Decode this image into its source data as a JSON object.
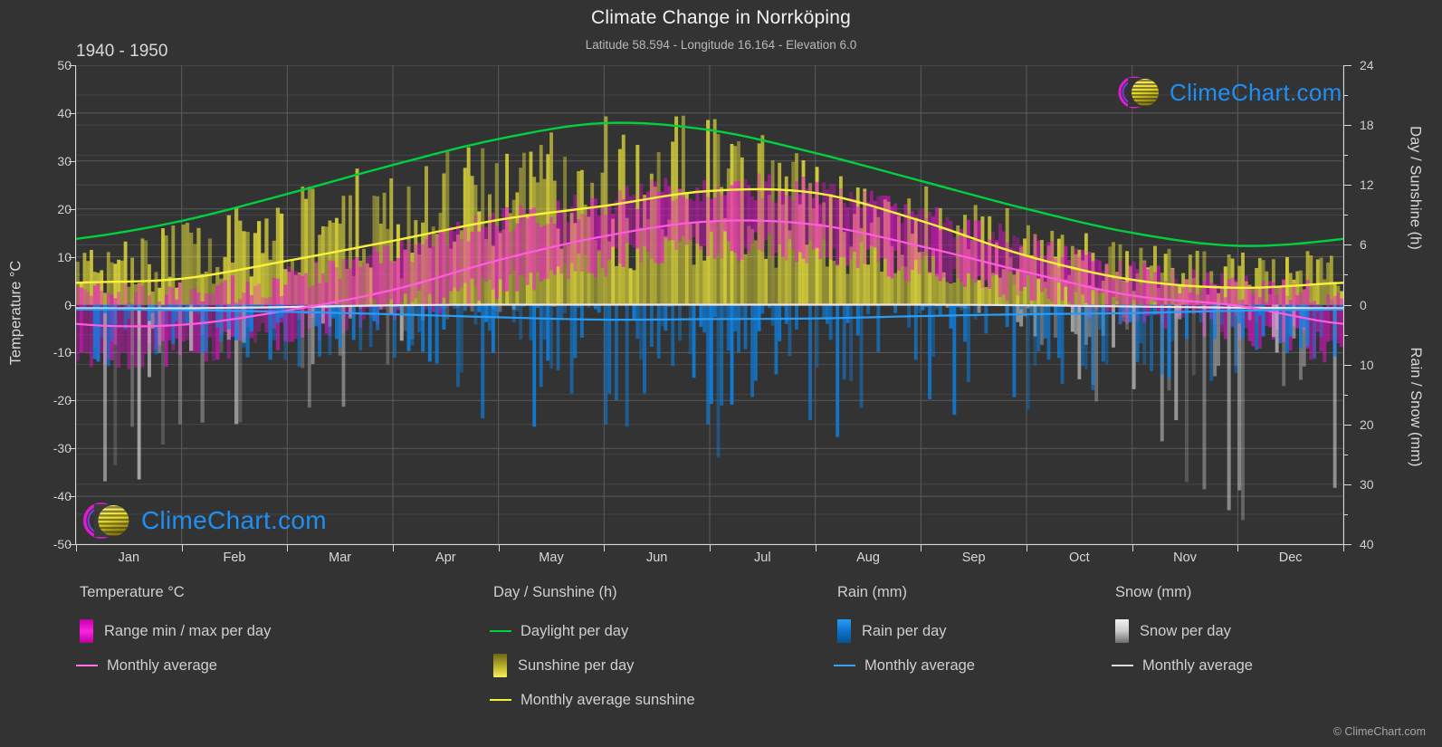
{
  "header": {
    "title": "Climate Change in Norrköping",
    "subtitle": "Latitude 58.594 - Longitude 16.164 - Elevation 6.0",
    "period": "1940 - 1950"
  },
  "axes": {
    "left_title": "Temperature °C",
    "right_title_top": "Day / Sunshine (h)",
    "right_title_bottom": "Rain / Snow (mm)",
    "left_ticks": [
      "50",
      "40",
      "30",
      "20",
      "10",
      "0",
      "-10",
      "-20",
      "-30",
      "-40",
      "-50"
    ],
    "right_ticks_top": [
      "24",
      "18",
      "12",
      "6",
      "0"
    ],
    "right_ticks_bottom": [
      "0",
      "10",
      "20",
      "30",
      "40"
    ],
    "x_ticks": [
      "Jan",
      "Feb",
      "Mar",
      "Apr",
      "May",
      "Jun",
      "Jul",
      "Aug",
      "Sep",
      "Oct",
      "Nov",
      "Dec"
    ]
  },
  "legend": {
    "groups": [
      {
        "heading": "Temperature °C",
        "items": [
          {
            "label": "Range min / max per day",
            "style": "swatch",
            "color": "#ff00d4"
          },
          {
            "label": "Monthly average",
            "style": "line",
            "color": "#ff74e0"
          }
        ]
      },
      {
        "heading": "Day / Sunshine (h)",
        "items": [
          {
            "label": "Daylight per day",
            "style": "line",
            "color": "#00d13f"
          },
          {
            "label": "Sunshine per day",
            "style": "swatch",
            "color": "#f2ef4a"
          },
          {
            "label": "Monthly average sunshine",
            "style": "line",
            "color": "#f5f03c"
          }
        ]
      },
      {
        "heading": "Rain (mm)",
        "items": [
          {
            "label": "Rain per day",
            "style": "swatch",
            "color": "#0b84e8"
          },
          {
            "label": "Monthly average",
            "style": "line",
            "color": "#3aa0f0"
          }
        ]
      },
      {
        "heading": "Snow (mm)",
        "items": [
          {
            "label": "Snow per day",
            "style": "swatch",
            "color": "#e8e8e8"
          },
          {
            "label": "Monthly average",
            "style": "line",
            "color": "#dcdcdc"
          }
        ]
      }
    ]
  },
  "watermark": {
    "text": "ClimeChart.com",
    "copyright": "© ClimeChart.com"
  },
  "chart_data": {
    "type": "line",
    "title": "Climate Change in Norrköping",
    "subtitle": "Latitude 58.594 - Longitude 16.164 - Elevation 6.0",
    "period": "1940 - 1950",
    "xlabel": "",
    "ylabel": "Temperature °C",
    "ylim": [
      -50,
      50
    ],
    "y2lim_day_sunshine_h": [
      0,
      24
    ],
    "y2lim_rain_snow_mm": [
      0,
      40
    ],
    "grid": true,
    "legend_position": "below",
    "categories": [
      "Jan",
      "Feb",
      "Mar",
      "Apr",
      "May",
      "Jun",
      "Jul",
      "Aug",
      "Sep",
      "Oct",
      "Nov",
      "Dec"
    ],
    "series": [
      {
        "name": "Daylight per day",
        "unit": "h",
        "axis": "right-day-sunshine",
        "color": "#00d13f",
        "values": [
          6.6,
          8.4,
          11.1,
          14.0,
          16.6,
          18.2,
          17.5,
          15.2,
          12.4,
          9.6,
          7.2,
          5.9
        ]
      },
      {
        "name": "Monthly average sunshine",
        "unit": "h",
        "axis": "right-day-sunshine",
        "color": "#f5f03c",
        "values": [
          2.2,
          2.6,
          4.4,
          6.4,
          8.5,
          9.9,
          11.4,
          11.2,
          8.4,
          4.9,
          2.5,
          1.7
        ]
      },
      {
        "name": "Monthly average temperature",
        "unit": "°C",
        "axis": "left",
        "color": "#ff74e0",
        "values": [
          -4.0,
          -4.2,
          -1.2,
          3.1,
          9.3,
          14.3,
          17.4,
          16.7,
          12.2,
          6.8,
          1.9,
          -0.2
        ]
      },
      {
        "name": "Monthly average rain",
        "unit": "mm",
        "axis": "right-rain-snow",
        "color": "#3aa0f0",
        "values": [
          0.8,
          0.9,
          1.2,
          1.6,
          2.1,
          2.5,
          2.4,
          2.3,
          1.9,
          1.6,
          1.4,
          1.0
        ]
      },
      {
        "name": "Monthly average snow",
        "unit": "mm",
        "axis": "right-rain-snow",
        "color": "#dcdcdc",
        "values": [
          0.6,
          0.6,
          0.4,
          0.1,
          0.0,
          0.0,
          0.0,
          0.0,
          0.0,
          0.1,
          0.3,
          0.5
        ]
      }
    ],
    "daily_bands": [
      {
        "name": "Range min / max per day",
        "unit": "°C",
        "axis": "left",
        "color": "#ff00d4",
        "monthly_min": [
          -9.5,
          -10.0,
          -6.0,
          -1.0,
          4.0,
          9.0,
          12.0,
          11.5,
          7.5,
          3.0,
          -1.5,
          -5.0
        ],
        "monthly_max": [
          0.5,
          0.5,
          3.5,
          9.0,
          15.5,
          20.0,
          23.0,
          22.0,
          17.0,
          11.0,
          5.0,
          2.0
        ]
      },
      {
        "name": "Sunshine per day",
        "unit": "h",
        "axis": "right-day-sunshine",
        "color": "#f2ef4a",
        "monthly_max": [
          5.5,
          7.5,
          10.5,
          13.5,
          16.0,
          17.5,
          17.0,
          14.5,
          11.5,
          8.5,
          6.0,
          5.0
        ]
      },
      {
        "name": "Rain per day",
        "unit": "mm",
        "axis": "right-rain-snow",
        "color": "#0b84e8",
        "monthly_max": [
          12,
          10,
          14,
          16,
          20,
          24,
          26,
          24,
          20,
          18,
          16,
          12
        ]
      },
      {
        "name": "Snow per day",
        "unit": "mm",
        "axis": "right-rain-snow",
        "color": "#e8e8e8",
        "monthly_max": [
          34,
          30,
          26,
          10,
          2,
          0,
          0,
          0,
          0,
          6,
          22,
          38
        ]
      }
    ]
  }
}
